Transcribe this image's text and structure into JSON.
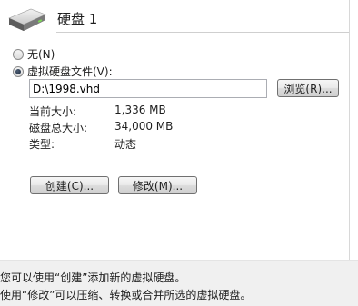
{
  "header": {
    "title": "硬盘 1",
    "icon": "hard-disk-icon"
  },
  "options": {
    "none_label": "无(N)",
    "file_label": "虚拟硬盘文件(V):",
    "selected": "file"
  },
  "file": {
    "path_value": "D:\\1998.vhd",
    "browse_label": "浏览(R)..."
  },
  "details": {
    "current_size_label": "当前大小:",
    "current_size_value": "1,336 MB",
    "total_size_label": "磁盘总大小:",
    "total_size_value": "34,000 MB",
    "type_label": "类型:",
    "type_value": "动态"
  },
  "actions": {
    "create_label": "创建(C)...",
    "edit_label": "修改(M)..."
  },
  "help": {
    "line1": "您可以使用“创建”添加新的虚拟硬盘。",
    "line2": "使用“修改”可以压缩、转换或合并所选的虚拟硬盘。"
  }
}
